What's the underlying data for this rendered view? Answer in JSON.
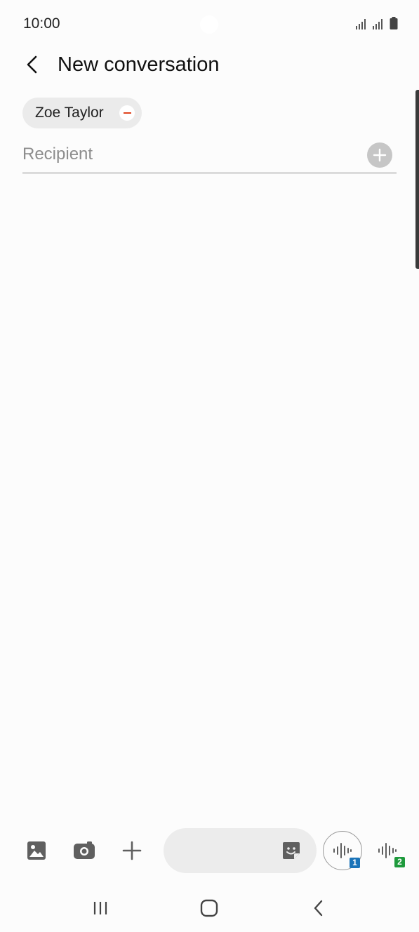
{
  "status_bar": {
    "time": "10:00",
    "icons": [
      "signal-sim1-icon",
      "signal-sim2-icon",
      "battery-icon"
    ]
  },
  "header": {
    "back_icon": "chevron-left-icon",
    "title": "New conversation"
  },
  "recipients": {
    "chips": [
      {
        "name": "Zoe Taylor",
        "remove_icon": "minus-circle-icon"
      }
    ],
    "input": {
      "value": "",
      "placeholder": "Recipient"
    },
    "add_icon": "plus-circle-icon"
  },
  "composer": {
    "gallery_icon": "image-icon",
    "camera_icon": "camera-icon",
    "attach_icon": "plus-icon",
    "message_input": {
      "value": "",
      "placeholder": ""
    },
    "sticker_icon": "sticker-icon",
    "voice_sim1": {
      "icon": "voice-wave-icon",
      "badge": "1",
      "badge_color": "#1a73b8"
    },
    "voice_sim2": {
      "icon": "voice-wave-icon",
      "badge": "2",
      "badge_color": "#1e9a3c"
    }
  },
  "nav_bar": {
    "recents_icon": "recents-icon",
    "home_icon": "home-icon",
    "back_icon": "back-icon"
  },
  "colors": {
    "background": "#fcfcfc",
    "chip_bg": "#ebebeb",
    "remove_accent": "#e0441e",
    "icon_gray": "#5f5f5f"
  }
}
